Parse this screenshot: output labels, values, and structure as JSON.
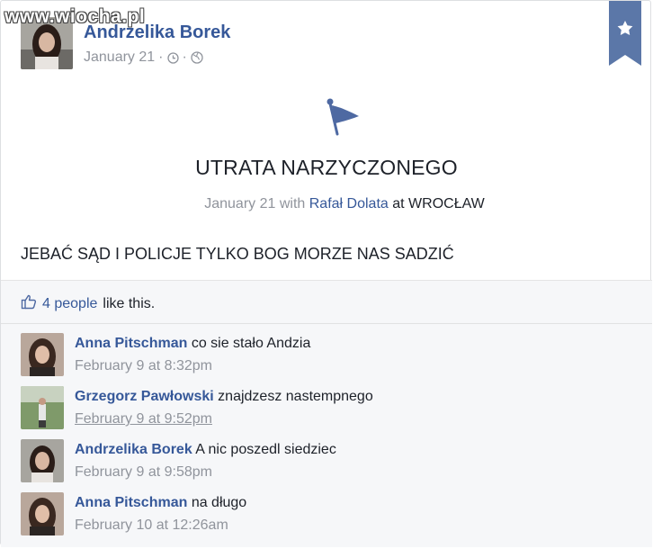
{
  "watermark": "www.wiocha.pl",
  "post": {
    "author": "Andrzelika Borek",
    "date": "January 21",
    "meta_sep1": "·",
    "meta_sep2": "·",
    "event_title": "UTRATA NARZYCZONEGO",
    "event_date": "January 21",
    "event_with": "with",
    "event_person": "Rafał Dolata",
    "event_at": "at",
    "event_place": "WROCŁAW",
    "text": "JEBAĆ SĄD I POLICJE TYLKO BOG MORZE NAS SADZIĆ"
  },
  "likes": {
    "count": "4 people",
    "suffix": "like this."
  },
  "comments": [
    {
      "name": "Anna Pitschman",
      "text": "co sie stało Andzia",
      "time": "February 9 at 8:32pm"
    },
    {
      "name": "Grzegorz Pawłowski",
      "text": "znajdzesz nastempnego",
      "time": "February 9 at 9:52pm"
    },
    {
      "name": "Andrzelika Borek",
      "text": "A nic poszedl siedziec",
      "time": "February 9 at 9:58pm"
    },
    {
      "name": "Anna Pitschman",
      "text": "na długo",
      "time": "February 10 at 12:26am"
    }
  ],
  "icons": {
    "clock": "clock-icon",
    "globe": "globe-icon",
    "bookmark": "bookmark-star-icon",
    "flag": "flag-icon",
    "like": "thumbs-up-icon"
  },
  "colors": {
    "link": "#365899",
    "text": "#1d2129",
    "muted": "#90949c",
    "bookmark": "#5b77a8",
    "panel": "#f6f7f9"
  }
}
